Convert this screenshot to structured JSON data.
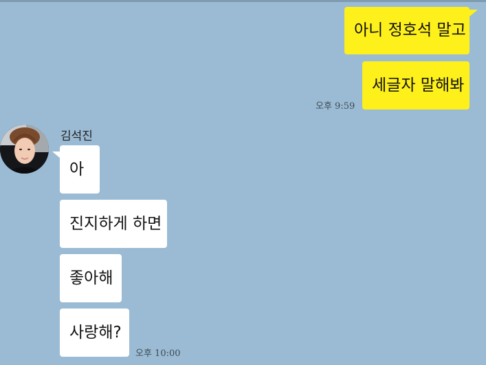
{
  "chat": {
    "outgoing": [
      {
        "text": "아니 정호석 말고"
      },
      {
        "text": "세글자 말해봐"
      }
    ],
    "outgoing_time": "오후 9:59",
    "sender_name": "김석진",
    "incoming": [
      {
        "text": "아"
      },
      {
        "text": "진지하게 하면"
      },
      {
        "text": "좋아해"
      },
      {
        "text": "사랑해?"
      }
    ],
    "incoming_time": "오후 10:00"
  },
  "colors": {
    "background": "#9bbbd4",
    "my_bubble": "#fef01b",
    "their_bubble": "#ffffff"
  },
  "icons": {
    "avatar": "profile-photo"
  }
}
